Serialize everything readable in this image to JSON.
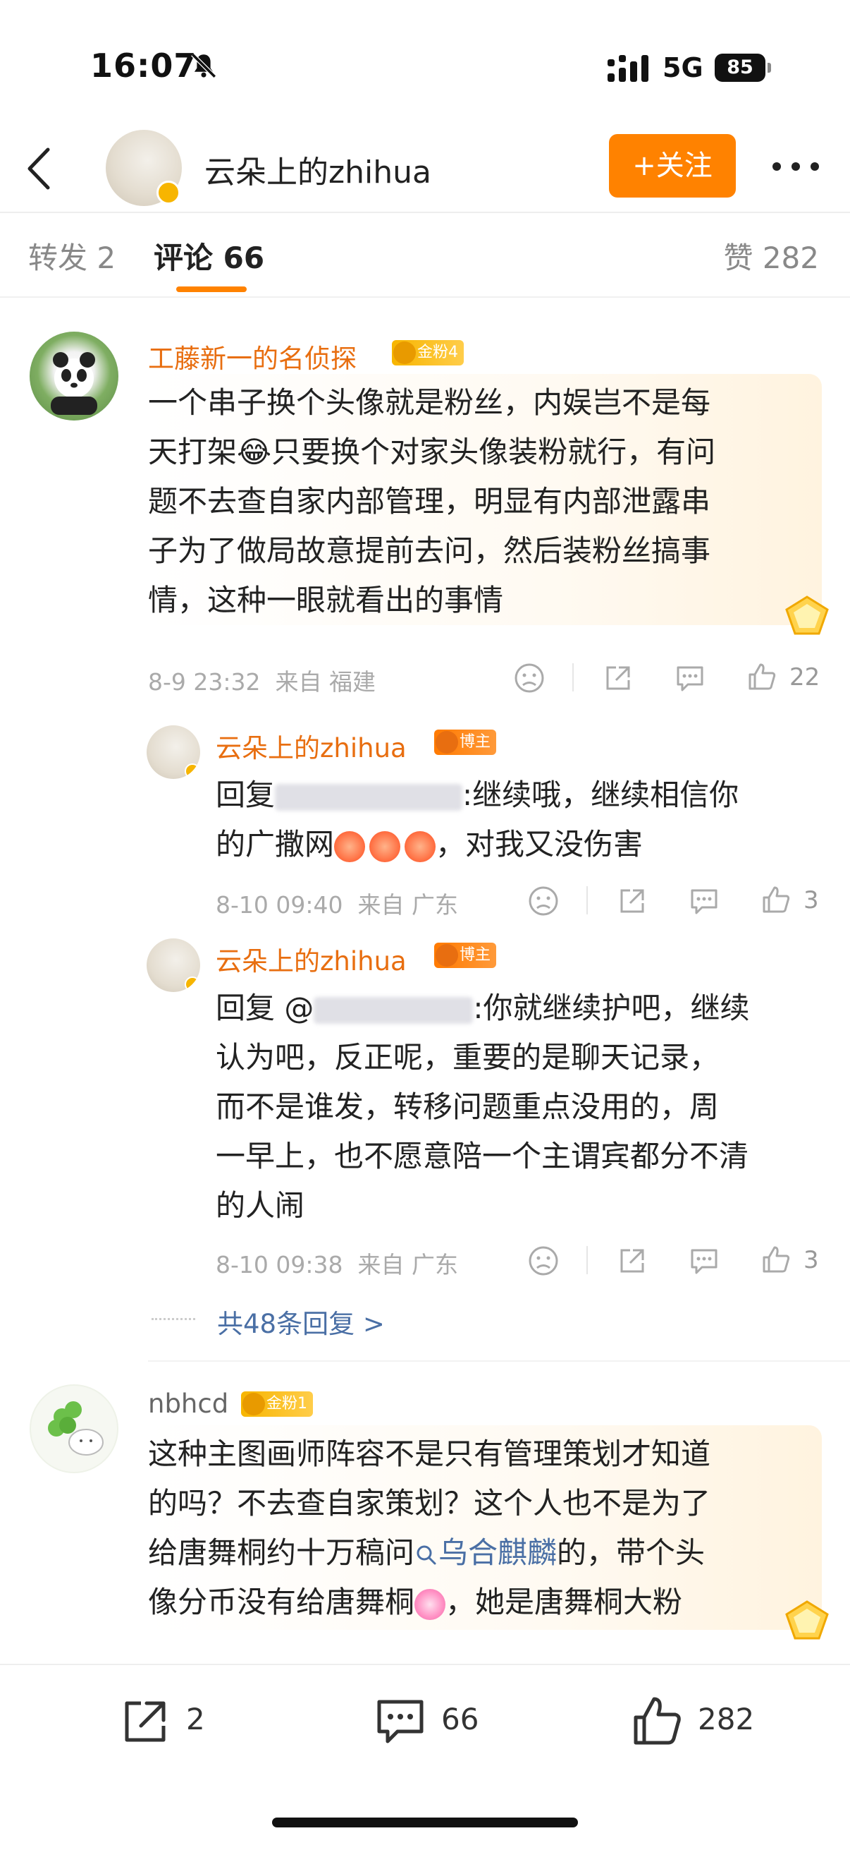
{
  "status_bar": {
    "time": "16:07",
    "network": "5G",
    "battery": "85"
  },
  "header": {
    "name": "云朵上的zhihua",
    "follow_label": "+关注"
  },
  "tabs": {
    "repost": "转发 2",
    "comment": "评论 66",
    "like": "赞 282"
  },
  "comments": [
    {
      "name": "工藤新一的名侦探",
      "badge": "金粉4",
      "text_lines": [
        "一个串子换个头像就是粉丝，内娱岂不是每",
        "天打架😂只要换个对家头像装粉就行，有问",
        "题不去查自家内部管理，明显有内部泄露串",
        "子为了做局故意提前去问，然后装粉丝搞事",
        "情，这种一眼就看出的事情"
      ],
      "time": "8-9 23:32",
      "location": "来自 福建",
      "likes": "22"
    },
    {
      "name": "云朵上的zhihua",
      "badge": "博主",
      "prefix": "回复",
      "after_mention": ":继续哦，继续相信你",
      "line2_before": "的广撒网",
      "line2_after": "，对我又没伤害",
      "time": "8-10 09:40",
      "location": "来自 广东",
      "likes": "3"
    },
    {
      "name": "云朵上的zhihua",
      "badge": "博主",
      "prefix": "回复 @",
      "after_mention": ":你就继续护吧，继续",
      "text_lines": [
        "认为吧，反正呢，重要的是聊天记录，",
        "而不是谁发，转移问题重点没用的，周",
        "一早上，也不愿意陪一个主谓宾都分不清",
        "的人闹"
      ],
      "time": "8-10 09:38",
      "location": "来自 广东",
      "likes": "3"
    },
    {
      "name": "nbhcd",
      "badge": "金粉1",
      "line1": "这种主图画师阵容不是只有管理策划才知道",
      "line2": "的吗？不去查自家策划？这个人也不是为了",
      "line3_before": "给唐舞桐约十万稿问",
      "line3_link": "乌合麒麟",
      "line3_after": "的，带个头",
      "line4_before": "像分币没有给唐舞桐",
      "line4_after": "，她是唐舞桐大粉"
    }
  ],
  "more_replies": "共48条回复 >",
  "bottom_bar": {
    "reposts": "2",
    "comments": "66",
    "likes": "282"
  },
  "colors": {
    "accent": "#ff8200",
    "name_orange": "#e86e10",
    "link_blue": "#4a6fa5",
    "badge_gold": "#f7b500",
    "badge_blogger": "#ff7a00"
  },
  "icons": [
    "bell-slash-icon",
    "signal-icon",
    "back-icon",
    "more-icon",
    "dislike-icon",
    "share-icon",
    "comment-icon",
    "like-icon",
    "search-icon",
    "gem-icon"
  ]
}
